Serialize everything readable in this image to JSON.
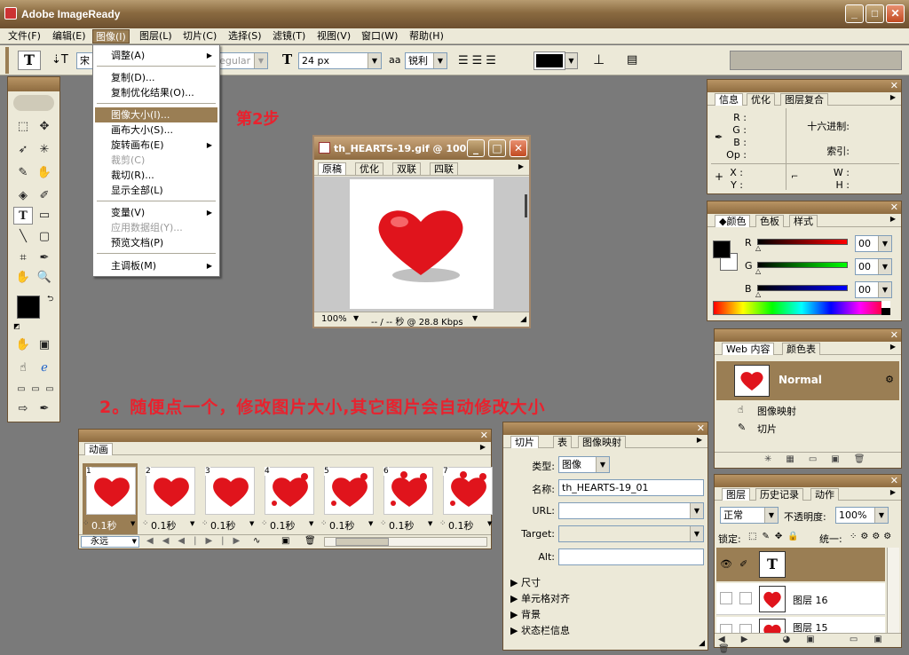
{
  "window": {
    "title": "Adobe ImageReady",
    "min": "_",
    "max": "□",
    "close": "✕"
  },
  "menubar": [
    "文件(F)",
    "编辑(E)",
    "图像(I)",
    "图层(L)",
    "切片(C)",
    "选择(S)",
    "滤镜(T)",
    "视图(V)",
    "窗口(W)",
    "帮助(H)"
  ],
  "image_menu": {
    "items": [
      "调整(A)",
      "复制(D)...",
      "复制优化结果(O)...",
      "图像大小(I)...",
      "画布大小(S)...",
      "旋转画布(E)",
      "裁剪(C)",
      "裁切(R)...",
      "显示全部(L)",
      "变量(V)",
      "应用数据组(Y)...",
      "预览文档(P)",
      "主调板(M)"
    ]
  },
  "options_bar": {
    "font_family": "宋",
    "font_style": "Regular",
    "font_size": "24 px",
    "aa_label": "aa",
    "aa_value": "锐利"
  },
  "document": {
    "title": "th_HEARTS-19.gif @ 100...",
    "tabs": [
      "原稿",
      "优化",
      "双联",
      "四联"
    ],
    "zoom": "100%",
    "status": "-- / -- 秒 @ 28.8 Kbps"
  },
  "annotations": {
    "step": "第2步",
    "note": "2。随便点一个，修改图片大小,其它图片会自动修改大小"
  },
  "animation": {
    "tab": "动画",
    "frames": [
      {
        "num": "1",
        "time": "0.1秒"
      },
      {
        "num": "2",
        "time": "0.1秒"
      },
      {
        "num": "3",
        "time": "0.1秒"
      },
      {
        "num": "4",
        "time": "0.1秒"
      },
      {
        "num": "5",
        "time": "0.1秒"
      },
      {
        "num": "6",
        "time": "0.1秒"
      },
      {
        "num": "7",
        "time": "0.1秒"
      }
    ],
    "loop": "永远"
  },
  "slice_panel": {
    "tabs": [
      "切片",
      "表",
      "图像映射"
    ],
    "type_label": "类型:",
    "type_value": "图像",
    "name_label": "名称:",
    "name_value": "th_HEARTS-19_01",
    "url_label": "URL:",
    "target_label": "Target:",
    "alt_label": "Alt:",
    "sections": [
      "尺寸",
      "单元格对齐",
      "背景",
      "状态栏信息"
    ]
  },
  "info_panel": {
    "tabs": [
      "信息",
      "优化",
      "图层复合"
    ],
    "rgb": [
      "R :",
      "G :",
      "B :",
      "Op :"
    ],
    "hex_label": "十六进制:",
    "index_label": "索引:",
    "xy": [
      "X :",
      "Y :"
    ],
    "wh": [
      "W :",
      "H :"
    ]
  },
  "color_panel": {
    "tabs": [
      "颜色",
      "色板",
      "样式"
    ],
    "channels": [
      {
        "name": "R",
        "value": "00"
      },
      {
        "name": "G",
        "value": "00"
      },
      {
        "name": "B",
        "value": "00"
      }
    ]
  },
  "web_panel": {
    "tabs": [
      "Web 内容",
      "颜色表"
    ],
    "normal": "Normal",
    "image_map": "图像映射",
    "slice": "切片"
  },
  "layers_panel": {
    "tabs": [
      "图层",
      "历史记录",
      "动作"
    ],
    "blend": "正常",
    "opacity_label": "不透明度:",
    "opacity": "100%",
    "lock_label": "锁定:",
    "unify_label": "统一:",
    "layers": [
      "图层 16",
      "图层 15"
    ]
  },
  "colors": {
    "accent": "#9a7e54",
    "annotation": "#e8222e"
  }
}
